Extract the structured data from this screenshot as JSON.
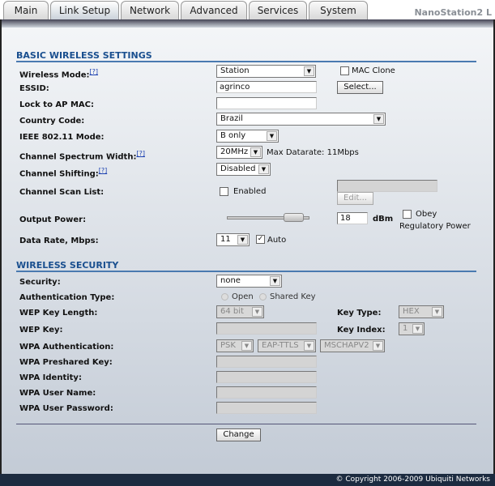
{
  "tabs": [
    "Main",
    "Link Setup",
    "Network",
    "Advanced",
    "Services",
    "System"
  ],
  "active_tab": "Link Setup",
  "brand": "NanoStation2 L",
  "basic": {
    "title": "BASIC WIRELESS SETTINGS",
    "wireless_mode_label": "Wireless Mode:",
    "help": "[?]",
    "wireless_mode": "Station",
    "mac_clone": "MAC Clone",
    "essid_label": "ESSID:",
    "essid": "agrinco",
    "select_btn": "Select...",
    "lock_ap_label": "Lock to AP MAC:",
    "lock_ap": "",
    "country_label": "Country Code:",
    "country": "Brazil",
    "ieee_label": "IEEE 802.11 Mode:",
    "ieee": "B only",
    "spectrum_label": "Channel Spectrum Width:",
    "spectrum": "20MHz",
    "max_datarate": "Max Datarate: 11Mbps",
    "shifting_label": "Channel Shifting:",
    "shifting": "Disabled",
    "scan_label": "Channel Scan List:",
    "scan_enabled": "Enabled",
    "edit_btn": "Edit...",
    "power_label": "Output Power:",
    "power": "18",
    "power_unit": "dBm",
    "obey": "Obey",
    "regulatory": "Regulatory Power",
    "power_slider_fraction": 0.85,
    "rate_label": "Data Rate, Mbps:",
    "rate": "11",
    "auto": "Auto"
  },
  "security": {
    "title": "WIRELESS SECURITY",
    "security_label": "Security:",
    "security": "none",
    "auth_label": "Authentication Type:",
    "open": "Open",
    "shared": "Shared Key",
    "wep_len_label": "WEP Key Length:",
    "wep_len": "64 bit",
    "key_type_label": "Key Type:",
    "key_type": "HEX",
    "wep_key_label": "WEP Key:",
    "key_index_label": "Key Index:",
    "key_index": "1",
    "wpa_auth_label": "WPA Authentication:",
    "wpa_auth": "PSK",
    "eap": "EAP-TTLS",
    "mschap": "MSCHAPV2",
    "psk_label": "WPA Preshared Key:",
    "identity_label": "WPA Identity:",
    "user_label": "WPA User Name:",
    "pass_label": "WPA User Password:"
  },
  "change_btn": "Change",
  "footer": "© Copyright 2006-2009 Ubiquiti Networks"
}
